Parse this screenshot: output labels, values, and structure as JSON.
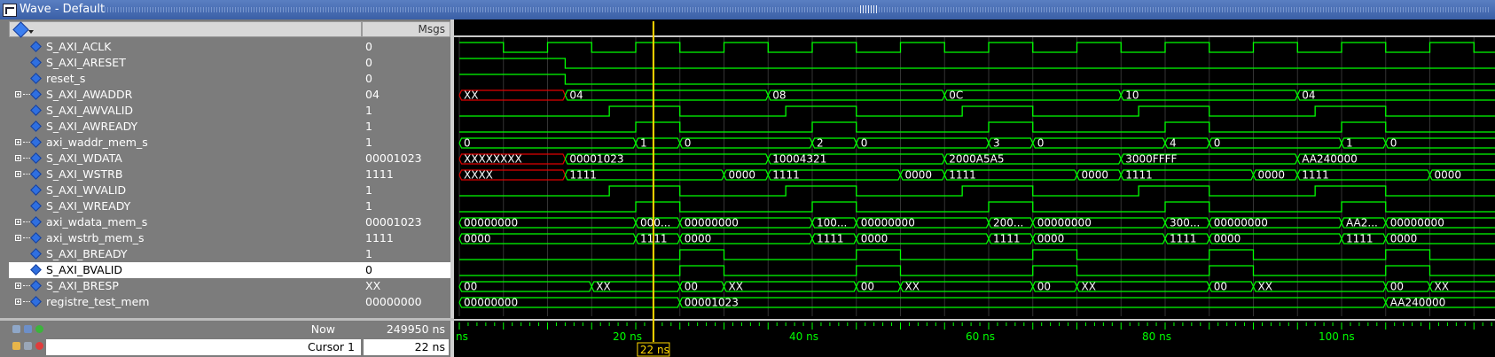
{
  "window": {
    "title": "Wave - Default"
  },
  "header": {
    "msgs_label": "Msgs"
  },
  "signals": [
    {
      "name": "S_AXI_ACLK",
      "value": "0",
      "bus": false
    },
    {
      "name": "S_AXI_ARESET",
      "value": "0",
      "bus": false
    },
    {
      "name": "reset_s",
      "value": "0",
      "bus": false
    },
    {
      "name": "S_AXI_AWADDR",
      "value": "04",
      "bus": true
    },
    {
      "name": "S_AXI_AWVALID",
      "value": "1",
      "bus": false
    },
    {
      "name": "S_AXI_AWREADY",
      "value": "1",
      "bus": false
    },
    {
      "name": "axi_waddr_mem_s",
      "value": "1",
      "bus": true
    },
    {
      "name": "S_AXI_WDATA",
      "value": "00001023",
      "bus": true
    },
    {
      "name": "S_AXI_WSTRB",
      "value": "1111",
      "bus": true
    },
    {
      "name": "S_AXI_WVALID",
      "value": "1",
      "bus": false
    },
    {
      "name": "S_AXI_WREADY",
      "value": "1",
      "bus": false
    },
    {
      "name": "axi_wdata_mem_s",
      "value": "00001023",
      "bus": true
    },
    {
      "name": "axi_wstrb_mem_s",
      "value": "1111",
      "bus": true
    },
    {
      "name": "S_AXI_BREADY",
      "value": "1",
      "bus": false
    },
    {
      "name": "S_AXI_BVALID",
      "value": "0",
      "bus": false,
      "selected": true
    },
    {
      "name": "S_AXI_BRESP",
      "value": "XX",
      "bus": true
    },
    {
      "name": "registre_test_mem",
      "value": "00000000",
      "bus": true
    }
  ],
  "bottom": {
    "now_label": "Now",
    "now_value": "249950 ns",
    "cursor_label": "Cursor 1",
    "cursor_value": "22 ns",
    "cursor_flag": "22 ns"
  },
  "timeline": {
    "ticks": [
      "ns",
      "20 ns",
      "40 ns",
      "60 ns",
      "80 ns",
      "100 ns"
    ],
    "cursor_time_ns": 22
  },
  "bus_segments": {
    "S_AXI_AWADDR": [
      [
        "XX",
        0,
        12,
        "red"
      ],
      [
        "04",
        12,
        35
      ],
      [
        "08",
        35,
        55
      ],
      [
        "0C",
        55,
        75
      ],
      [
        "10",
        75,
        95
      ],
      [
        "04",
        95,
        118
      ]
    ],
    "axi_waddr_mem_s": [
      [
        "0",
        0,
        20
      ],
      [
        "1",
        20,
        25
      ],
      [
        "0",
        25,
        40
      ],
      [
        "2",
        40,
        45
      ],
      [
        "0",
        45,
        60
      ],
      [
        "3",
        60,
        65
      ],
      [
        "0",
        65,
        80
      ],
      [
        "4",
        80,
        85
      ],
      [
        "0",
        85,
        100
      ],
      [
        "1",
        100,
        105
      ],
      [
        "0",
        105,
        118
      ]
    ],
    "S_AXI_WDATA": [
      [
        "XXXXXXXX",
        0,
        12,
        "red"
      ],
      [
        "00001023",
        12,
        35
      ],
      [
        "10004321",
        35,
        55
      ],
      [
        "2000A5A5",
        55,
        75
      ],
      [
        "3000FFFF",
        75,
        95
      ],
      [
        "AA240000",
        95,
        118
      ]
    ],
    "S_AXI_WSTRB": [
      [
        "XXXX",
        0,
        12,
        "red"
      ],
      [
        "1111",
        12,
        30
      ],
      [
        "0000",
        30,
        35
      ],
      [
        "1111",
        35,
        50
      ],
      [
        "0000",
        50,
        55
      ],
      [
        "1111",
        55,
        70
      ],
      [
        "0000",
        70,
        75
      ],
      [
        "1111",
        75,
        90
      ],
      [
        "0000",
        90,
        95
      ],
      [
        "1111",
        95,
        110
      ],
      [
        "0000",
        110,
        118
      ]
    ],
    "axi_wdata_mem_s": [
      [
        "00000000",
        0,
        20
      ],
      [
        "000...",
        20,
        25
      ],
      [
        "00000000",
        25,
        40
      ],
      [
        "100...",
        40,
        45
      ],
      [
        "00000000",
        45,
        60
      ],
      [
        "200...",
        60,
        65
      ],
      [
        "00000000",
        65,
        80
      ],
      [
        "300...",
        80,
        85
      ],
      [
        "00000000",
        85,
        100
      ],
      [
        "AA2...",
        100,
        105
      ],
      [
        "00000000",
        105,
        118
      ]
    ],
    "axi_wstrb_mem_s": [
      [
        "0000",
        0,
        20
      ],
      [
        "1111",
        20,
        25
      ],
      [
        "0000",
        25,
        40
      ],
      [
        "1111",
        40,
        45
      ],
      [
        "0000",
        45,
        60
      ],
      [
        "1111",
        60,
        65
      ],
      [
        "0000",
        65,
        80
      ],
      [
        "1111",
        80,
        85
      ],
      [
        "0000",
        85,
        100
      ],
      [
        "1111",
        100,
        105
      ],
      [
        "0000",
        105,
        118
      ]
    ],
    "S_AXI_BRESP": [
      [
        "00",
        0,
        15
      ],
      [
        "XX",
        15,
        25
      ],
      [
        "00",
        25,
        30
      ],
      [
        "XX",
        30,
        45
      ],
      [
        "00",
        45,
        50
      ],
      [
        "XX",
        50,
        65
      ],
      [
        "00",
        65,
        70
      ],
      [
        "XX",
        70,
        85
      ],
      [
        "00",
        85,
        90
      ],
      [
        "XX",
        90,
        105
      ],
      [
        "00",
        105,
        110
      ],
      [
        "XX",
        110,
        118
      ]
    ],
    "registre_test_mem": [
      [
        "00000000",
        0,
        25
      ],
      [
        "00001023",
        25,
        105
      ],
      [
        "AA240000",
        105,
        118
      ]
    ]
  },
  "bit_waves": {
    "S_AXI_ACLK": "clock",
    "S_AXI_ARESET": [
      [
        0,
        1
      ],
      [
        12,
        0
      ]
    ],
    "reset_s": [
      [
        0,
        1
      ],
      [
        12,
        0
      ]
    ],
    "S_AXI_AWVALID": [
      [
        0,
        0
      ],
      [
        17,
        1
      ],
      [
        25,
        0
      ],
      [
        37,
        1
      ],
      [
        45,
        0
      ],
      [
        57,
        1
      ],
      [
        65,
        0
      ],
      [
        77,
        1
      ],
      [
        85,
        0
      ],
      [
        97,
        1
      ],
      [
        105,
        0
      ]
    ],
    "S_AXI_AWREADY": [
      [
        0,
        0
      ],
      [
        20,
        1
      ],
      [
        25,
        0
      ],
      [
        40,
        1
      ],
      [
        45,
        0
      ],
      [
        60,
        1
      ],
      [
        65,
        0
      ],
      [
        80,
        1
      ],
      [
        85,
        0
      ],
      [
        100,
        1
      ],
      [
        105,
        0
      ]
    ],
    "S_AXI_WVALID": [
      [
        0,
        0
      ],
      [
        17,
        1
      ],
      [
        25,
        0
      ],
      [
        37,
        1
      ],
      [
        45,
        0
      ],
      [
        57,
        1
      ],
      [
        65,
        0
      ],
      [
        77,
        1
      ],
      [
        85,
        0
      ],
      [
        97,
        1
      ],
      [
        105,
        0
      ]
    ],
    "S_AXI_WREADY": [
      [
        0,
        0
      ],
      [
        20,
        1
      ],
      [
        25,
        0
      ],
      [
        40,
        1
      ],
      [
        45,
        0
      ],
      [
        60,
        1
      ],
      [
        65,
        0
      ],
      [
        80,
        1
      ],
      [
        85,
        0
      ],
      [
        100,
        1
      ],
      [
        105,
        0
      ]
    ],
    "S_AXI_BREADY": [
      [
        0,
        0
      ],
      [
        25,
        1
      ],
      [
        30,
        0
      ],
      [
        45,
        1
      ],
      [
        50,
        0
      ],
      [
        65,
        1
      ],
      [
        70,
        0
      ],
      [
        85,
        1
      ],
      [
        90,
        0
      ],
      [
        105,
        1
      ],
      [
        110,
        0
      ]
    ],
    "S_AXI_BVALID": [
      [
        0,
        0
      ],
      [
        25,
        1
      ],
      [
        30,
        0
      ],
      [
        45,
        1
      ],
      [
        50,
        0
      ],
      [
        65,
        1
      ],
      [
        70,
        0
      ],
      [
        85,
        1
      ],
      [
        90,
        0
      ],
      [
        105,
        1
      ],
      [
        110,
        0
      ]
    ]
  },
  "colors": {
    "wave": "#00ff00",
    "cursor": "#ffd700",
    "undefined": "#e00000",
    "grid": "#333333"
  }
}
